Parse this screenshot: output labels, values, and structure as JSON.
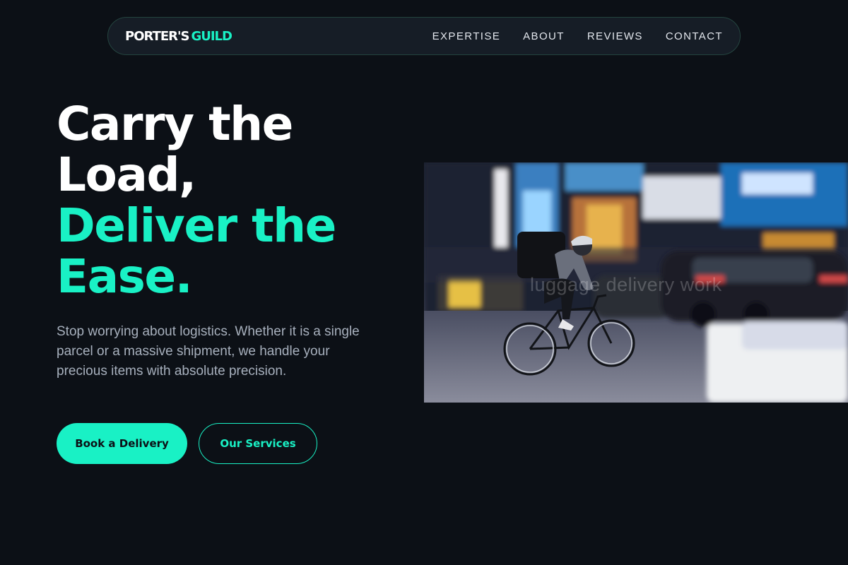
{
  "nav": {
    "logo_part1": "PORTER'S",
    "logo_part2": "GUILD",
    "items": [
      {
        "label": "EXPERTISE"
      },
      {
        "label": "ABOUT"
      },
      {
        "label": "REVIEWS"
      },
      {
        "label": "CONTACT"
      }
    ]
  },
  "hero": {
    "title_line1": "Carry the",
    "title_line2": "Load,",
    "title_line3": "Deliver the",
    "title_line4": "Ease.",
    "subtitle": "Stop worrying about logistics. Whether it is a single parcel or a massive shipment, we handle your precious items with absolute precision.",
    "primary_button": "Book a Delivery",
    "secondary_button": "Our Services"
  },
  "image": {
    "watermark": "luggage delivery work"
  },
  "colors": {
    "accent": "#19f1c5",
    "background": "#0c1016",
    "nav_background": "#161d26"
  }
}
